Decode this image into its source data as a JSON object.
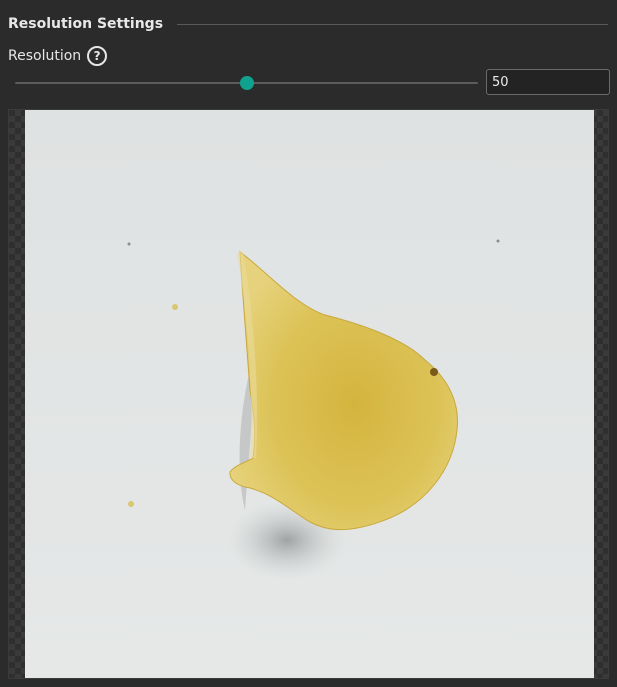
{
  "section": {
    "title": "Resolution Settings"
  },
  "resolution": {
    "label": "Resolution",
    "help_icon": "question-circle-icon",
    "value": "50",
    "slider_fraction": 0.5
  },
  "preview": {
    "subject": "potato chip on white surface"
  },
  "colors": {
    "accent": "#0fa38f",
    "background": "#2b2b2b",
    "chip": "#d9c24f"
  }
}
